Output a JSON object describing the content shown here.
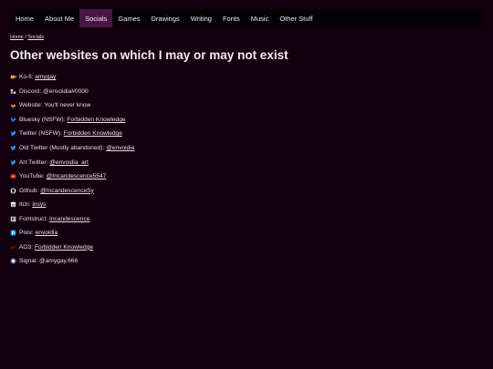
{
  "nav": {
    "items": [
      {
        "label": "Home",
        "active": false
      },
      {
        "label": "About Me",
        "active": false
      },
      {
        "label": "Socials",
        "active": true
      },
      {
        "label": "Games",
        "active": false
      },
      {
        "label": "Drawings",
        "active": false
      },
      {
        "label": "Writing",
        "active": false
      },
      {
        "label": "Fonts",
        "active": false
      },
      {
        "label": "Music",
        "active": false
      },
      {
        "label": "Other Stuff",
        "active": false
      }
    ]
  },
  "breadcrumb": {
    "home": "Home",
    "separator": "/",
    "current": "Socials"
  },
  "page_title": "Other websites on which I may or may not exist",
  "links": [
    {
      "icon": "ko-fi-icon",
      "label": "Ko-fi:",
      "value": "amygay",
      "is_link": true
    },
    {
      "icon": "discord-icon",
      "label": "Discord:",
      "value": "@envoidia#0000",
      "is_link": false
    },
    {
      "icon": "website-icon",
      "label": "Website:",
      "value": "You'll never know",
      "is_link": false
    },
    {
      "icon": "bluesky-icon",
      "label": "Bluesky (NSFW):",
      "value": "Forbidden Knowledge",
      "is_link": true
    },
    {
      "icon": "twitter-icon",
      "label": "Twitter (NSFW):",
      "value": "Forbidden Knowledge",
      "is_link": true
    },
    {
      "icon": "twitter-icon",
      "label": "Old Twitter (Mostly abandoned):",
      "value": "@envoidia",
      "is_link": true
    },
    {
      "icon": "twitter-icon",
      "label": "Art Twitter:",
      "value": "@envoidia_art",
      "is_link": true
    },
    {
      "icon": "youtube-icon",
      "label": "YouTube:",
      "value": "@Incandescence5547",
      "is_link": true
    },
    {
      "icon": "github-icon",
      "label": "Github:",
      "value": "@IncandescenceSy",
      "is_link": true
    },
    {
      "icon": "itch-icon",
      "label": "Itch:",
      "value": "insys",
      "is_link": true
    },
    {
      "icon": "fontstruct-icon",
      "label": "Fontstruct:",
      "value": "Incandescence",
      "is_link": true
    },
    {
      "icon": "pixiv-icon",
      "label": "Pixiv:",
      "value": "envoidia",
      "is_link": true
    },
    {
      "icon": "ao3-icon",
      "label": "AO3:",
      "value": "Forbidden Knowledge",
      "is_link": true
    },
    {
      "icon": "signal-icon",
      "label": "Signal:",
      "value": "@amygay.666",
      "is_link": false
    }
  ]
}
